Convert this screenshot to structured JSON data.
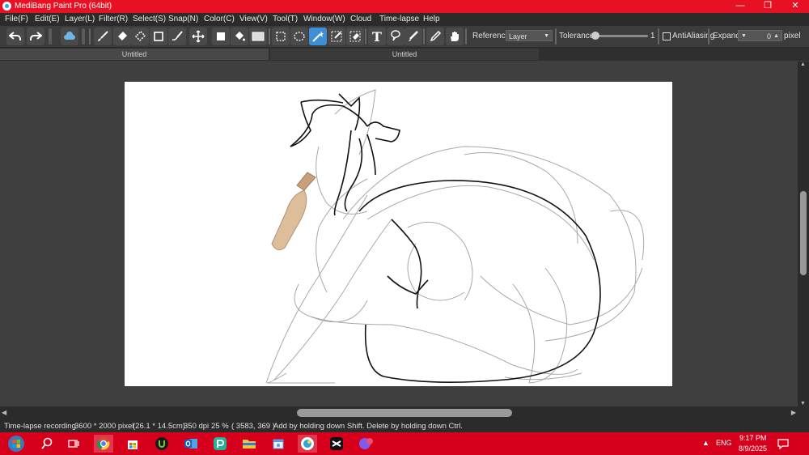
{
  "window": {
    "title": "MediBang Paint Pro (64bit)",
    "controls": {
      "minimize": "—",
      "restore": "❐",
      "close": "✕"
    }
  },
  "menu": [
    {
      "label": "File(F)"
    },
    {
      "label": "Edit(E)"
    },
    {
      "label": "Layer(L)"
    },
    {
      "label": "Filter(R)"
    },
    {
      "label": "Select(S)"
    },
    {
      "label": "Snap(N)"
    },
    {
      "label": "Color(C)"
    },
    {
      "label": "View(V)"
    },
    {
      "label": "Tool(T)"
    },
    {
      "label": "Window(W)"
    },
    {
      "label": "Cloud"
    },
    {
      "label": "Time-lapse"
    },
    {
      "label": "Help"
    }
  ],
  "toolbar": {
    "reference_label": "Reference",
    "reference_value": "Layer",
    "tolerance_label": "Tolerance",
    "tolerance_value": "1",
    "tolerance_level": 0.0,
    "antialiasing_label": "AntiAliasing",
    "expand_label": "Expand",
    "expand_value": "0",
    "unit": "pixel",
    "active_tool": "magic-wand",
    "text_tool_glyph": "T"
  },
  "tabs": [
    {
      "label": "Untitled"
    },
    {
      "label": "Untitled"
    }
  ],
  "status": {
    "mode": "Time-lapse recording",
    "size": "3600 * 2000 pixel",
    "physical": "(26.1 * 14.5cm)",
    "dpi": "350 dpi",
    "zoom": "25 %",
    "cursor": "( 3583, 369 )",
    "hint": "Add by holding down Shift. Delete by holding down Ctrl."
  },
  "taskbar": {
    "language": "ENG",
    "time": "9:17 PM",
    "date": "8/9/2025",
    "caret": "▲"
  },
  "colors": {
    "titlebar": "#e81123",
    "taskbar": "#d6001c",
    "accent": "#3f8fd4"
  }
}
